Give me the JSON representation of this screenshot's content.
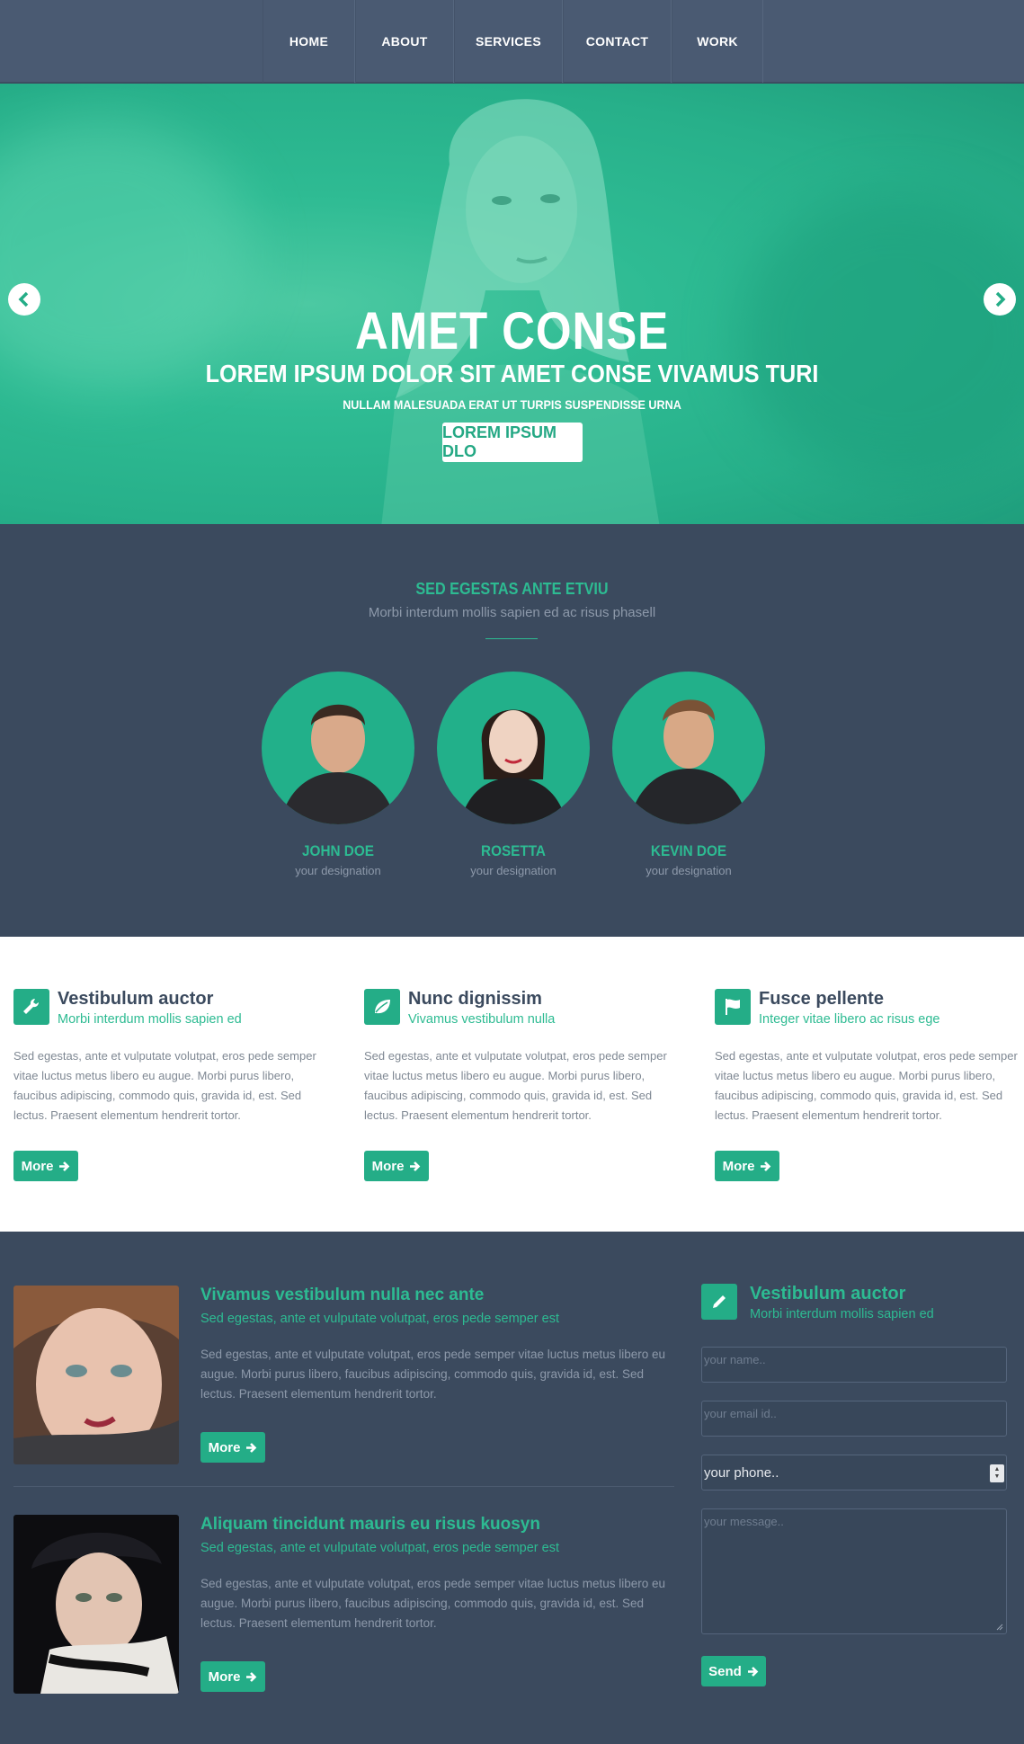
{
  "nav": {
    "items": [
      {
        "label": "HOME"
      },
      {
        "label": "ABOUT"
      },
      {
        "label": "SERVICES"
      },
      {
        "label": "CONTACT"
      },
      {
        "label": "WORK"
      }
    ]
  },
  "hero": {
    "title": "AMET CONSE",
    "subtitle": "LOREM IPSUM DOLOR SIT AMET CONSE VIVAMUS TURI",
    "tagline": "NULLAM MALESUADA ERAT UT TURPIS SUSPENDISSE URNA",
    "button": "LOREM IPSUM DLO",
    "prev_icon": "chevron-left-icon",
    "next_icon": "chevron-right-icon"
  },
  "team": {
    "title": "SED EGESTAS ANTE ETVIU",
    "subtitle": "Morbi interdum mollis sapien ed ac risus phasell",
    "members": [
      {
        "name": "JOHN DOE",
        "role": "your designation"
      },
      {
        "name": "ROSETTA",
        "role": "your designation"
      },
      {
        "name": "KEVIN DOE",
        "role": "your designation"
      }
    ]
  },
  "features": [
    {
      "icon": "wrench-icon",
      "title": "Vestibulum auctor",
      "subtitle": "Morbi interdum mollis sapien ed",
      "text": "Sed egestas, ante et vulputate volutpat, eros pede semper vitae luctus metus libero eu augue. Morbi purus libero, faucibus adipiscing, commodo quis, gravida id, est. Sed lectus. Praesent elementum hendrerit tortor.",
      "button": "More"
    },
    {
      "icon": "leaf-icon",
      "title": "Nunc dignissim",
      "subtitle": "Vivamus vestibulum nulla",
      "text": "Sed egestas, ante et vulputate volutpat, eros pede semper vitae luctus metus libero eu augue. Morbi purus libero, faucibus adipiscing, commodo quis, gravida id, est. Sed lectus. Praesent elementum hendrerit tortor.",
      "button": "More"
    },
    {
      "icon": "flag-icon",
      "title": "Fusce pellente",
      "subtitle": "Integer vitae libero ac risus ege",
      "text": "Sed egestas, ante et vulputate volutpat, eros pede semper vitae luctus metus libero eu augue. Morbi purus libero, faucibus adipiscing, commodo quis, gravida id, est. Sed lectus. Praesent elementum hendrerit tortor.",
      "button": "More"
    }
  ],
  "posts": [
    {
      "title": "Vivamus vestibulum nulla nec ante",
      "subtitle": "Sed egestas, ante et vulputate volutpat, eros pede semper est",
      "text": "Sed egestas, ante et vulputate volutpat, eros pede semper vitae luctus metus libero eu augue. Morbi purus libero, faucibus adipiscing, commodo quis, gravida id, est. Sed lectus. Praesent elementum hendrerit tortor.",
      "button": "More"
    },
    {
      "title": "Aliquam tincidunt mauris eu risus kuosyn",
      "subtitle": "Sed egestas, ante et vulputate volutpat, eros pede semper est",
      "text": "Sed egestas, ante et vulputate volutpat, eros pede semper vitae luctus metus libero eu augue. Morbi purus libero, faucibus adipiscing, commodo quis, gravida id, est. Sed lectus. Praesent elementum hendrerit tortor.",
      "button": "More"
    }
  ],
  "contact": {
    "icon": "pencil-icon",
    "title": "Vestibulum auctor",
    "subtitle": "Morbi interdum mollis sapien ed",
    "name_placeholder": "your name..",
    "email_placeholder": "your email id..",
    "phone_value": "your phone..",
    "message_placeholder": "your message..",
    "button": "Send"
  },
  "colors": {
    "accent": "#24ad87",
    "dark": "#3b4a5e",
    "nav": "#4a5a72"
  }
}
